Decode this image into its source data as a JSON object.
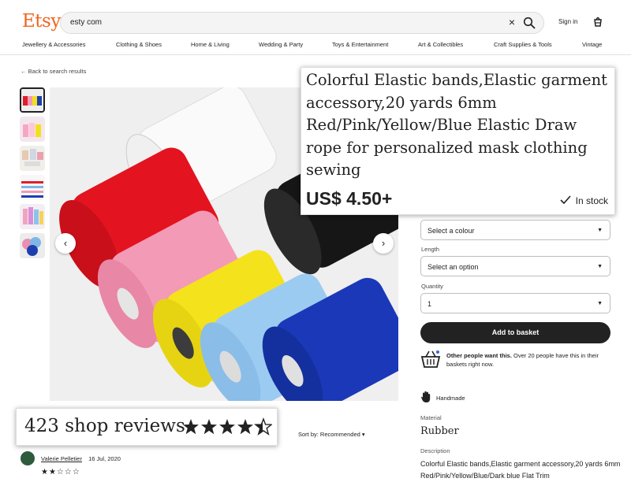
{
  "header": {
    "logo": "Etsy",
    "search_value": "esty com",
    "sign_in": "Sign in",
    "nav": [
      "Jewellery & Accessories",
      "Clothing & Shoes",
      "Home & Living",
      "Wedding & Party",
      "Toys & Entertainment",
      "Art & Collectibles",
      "Craft Supplies & Tools",
      "Vintage"
    ]
  },
  "back_link": "Back to search results",
  "gallery": {
    "prev_arrow": "‹",
    "next_arrow": "›"
  },
  "listing": {
    "title": "Colorful Elastic bands,Elastic garment accessory,20 yards 6mm Red/Pink/Yellow/Blue Elastic Draw rope for personalized mask clothing sewing",
    "price": "US$ 4.50+",
    "stock": "In stock",
    "colour_select": "Select a colour",
    "length_label": "Length",
    "length_select": "Select an option",
    "quantity_label": "Quantity",
    "quantity_value": "1",
    "add_to_basket": "Add to basket",
    "others_bold": "Other people want this.",
    "others_rest": " Over 20 people have this in their baskets right now.",
    "handmade": "Handmade",
    "material_label": "Material",
    "material_value": "Rubber",
    "description_label": "Description",
    "description_text": "Colorful Elastic bands,Elastic garment accessory,20 yards 6mm Red/Pink/Yellow/Blue/Dark blue Flat Trim"
  },
  "reviews": {
    "count_text": "423 shop reviews",
    "rating": 4.5,
    "sort_label": "Sort by: Recommended",
    "reviewer_name": "Valerie Pelletier",
    "review_date": "16 Jul, 2020",
    "review_stars": "★★☆☆☆"
  },
  "colors": {
    "brand": "#f1641e",
    "button": "#222222"
  }
}
